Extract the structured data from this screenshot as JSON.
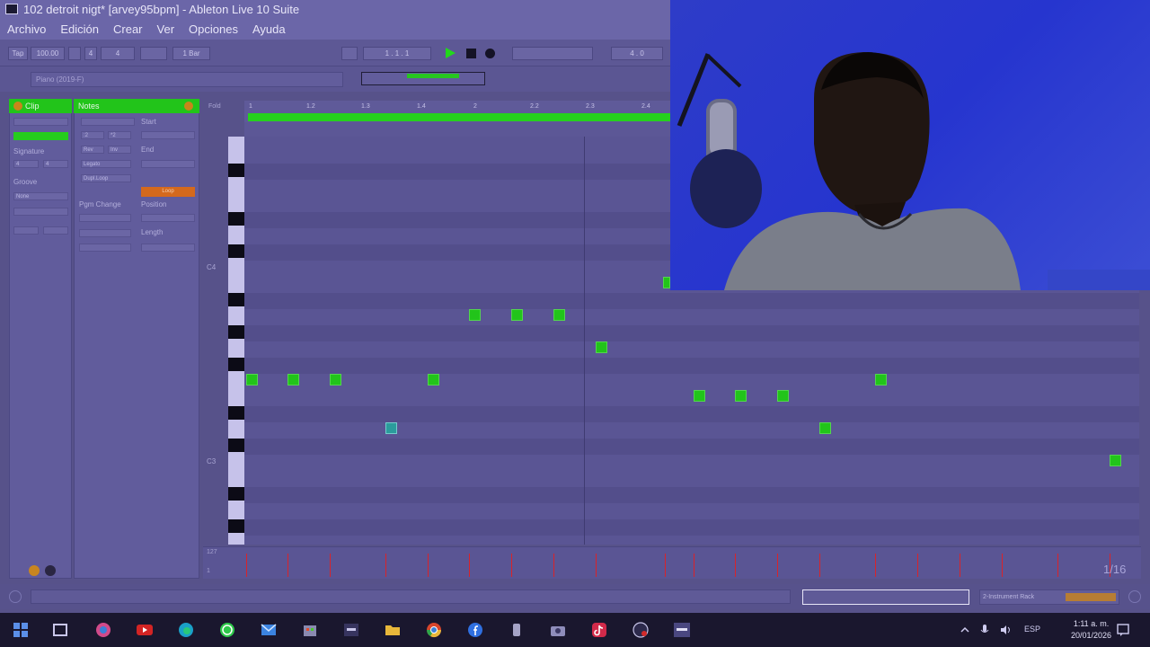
{
  "window": {
    "title": "102 detroit nigt* [arvey95bpm] - Ableton Live 10 Suite"
  },
  "menu": [
    "Archivo",
    "Edición",
    "Crear",
    "Ver",
    "Opciones",
    "Ayuda"
  ],
  "transport": {
    "tap": "Tap",
    "tempo": "100.00",
    "signature_num": "4",
    "signature_den": "4",
    "loop_quant": "1 Bar",
    "position": "1 . 1 . 1",
    "end": "4 . 0"
  },
  "overview": {
    "field_placeholder": "Piano (2019-F)"
  },
  "clip": {
    "header": "Clip",
    "signature_label": "Signature",
    "signature_num": "4",
    "signature_den": "4",
    "groove_label": "Groove",
    "groove_value": "None"
  },
  "notes": {
    "header": "Notes",
    "start_label": "Start",
    "end_label": "End",
    "position_label": "Position",
    "length_label": "Length",
    "pgm_change_label": "Pgm Change",
    "orange_button": "Loop",
    "buttons": [
      "Rev",
      "Inv",
      "Legato",
      "Dupl.Loop",
      ":2",
      "*2"
    ]
  },
  "ruler": {
    "labels": [
      "1",
      "1.2",
      "1.3",
      "1.4",
      "2",
      "2.2",
      "2.3",
      "2.4"
    ],
    "fold": "Fold"
  },
  "octaves": [
    "C4",
    "C3"
  ],
  "velocity": {
    "top": "127",
    "bottom": "1"
  },
  "grid_value": "1/16",
  "status": {
    "track_label": "2-Instrument Rack"
  },
  "taskbar": {
    "icons": [
      "windows-start-icon",
      "task-view-icon",
      "copilot-icon",
      "youtube-icon",
      "edge-icon",
      "whatsapp-icon",
      "mail-icon",
      "store-icon",
      "ableton-icon",
      "files-icon",
      "chrome-icon",
      "facebook-icon",
      "usb-icon",
      "camera-icon",
      "tiktok-icon",
      "obs-icon",
      "ableton-active-icon"
    ],
    "language": "ESP",
    "time": "1:11 a. m.",
    "date": "20/01/2026"
  },
  "colors": {
    "accent": "#22c41a",
    "overlay": "#57528a",
    "orange": "#d4691d",
    "velocity": "#d9232a"
  }
}
